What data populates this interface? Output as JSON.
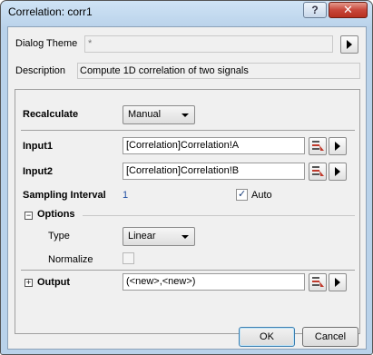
{
  "window": {
    "title": "Correlation: corr1",
    "help_label": "?",
    "close_label": "✕"
  },
  "theme": {
    "label": "Dialog Theme",
    "value": "*"
  },
  "description": {
    "label": "Description",
    "value": "Compute 1D correlation of two signals"
  },
  "recalculate": {
    "label": "Recalculate",
    "value": "Manual"
  },
  "input1": {
    "label": "Input1",
    "value": "[Correlation]Correlation!A"
  },
  "input2": {
    "label": "Input2",
    "value": "[Correlation]Correlation!B"
  },
  "sampling": {
    "label": "Sampling Interval",
    "value": "1",
    "auto_label": "Auto",
    "auto_checked": true
  },
  "options": {
    "label": "Options",
    "type_label": "Type",
    "type_value": "Linear",
    "normalize_label": "Normalize",
    "normalize_checked": false
  },
  "output": {
    "label": "Output",
    "value": "(<new>,<new>)"
  },
  "buttons": {
    "ok": "OK",
    "cancel": "Cancel"
  },
  "colors": {
    "link_blue": "#1f4ea3",
    "titlebar": "#b9d2ea",
    "close_red": "#c8463a",
    "picker_red": "#c0392b"
  },
  "icons": {
    "toggle_collapsed": "⊞",
    "toggle_expanded": "⊟",
    "checkmark": "✓"
  }
}
